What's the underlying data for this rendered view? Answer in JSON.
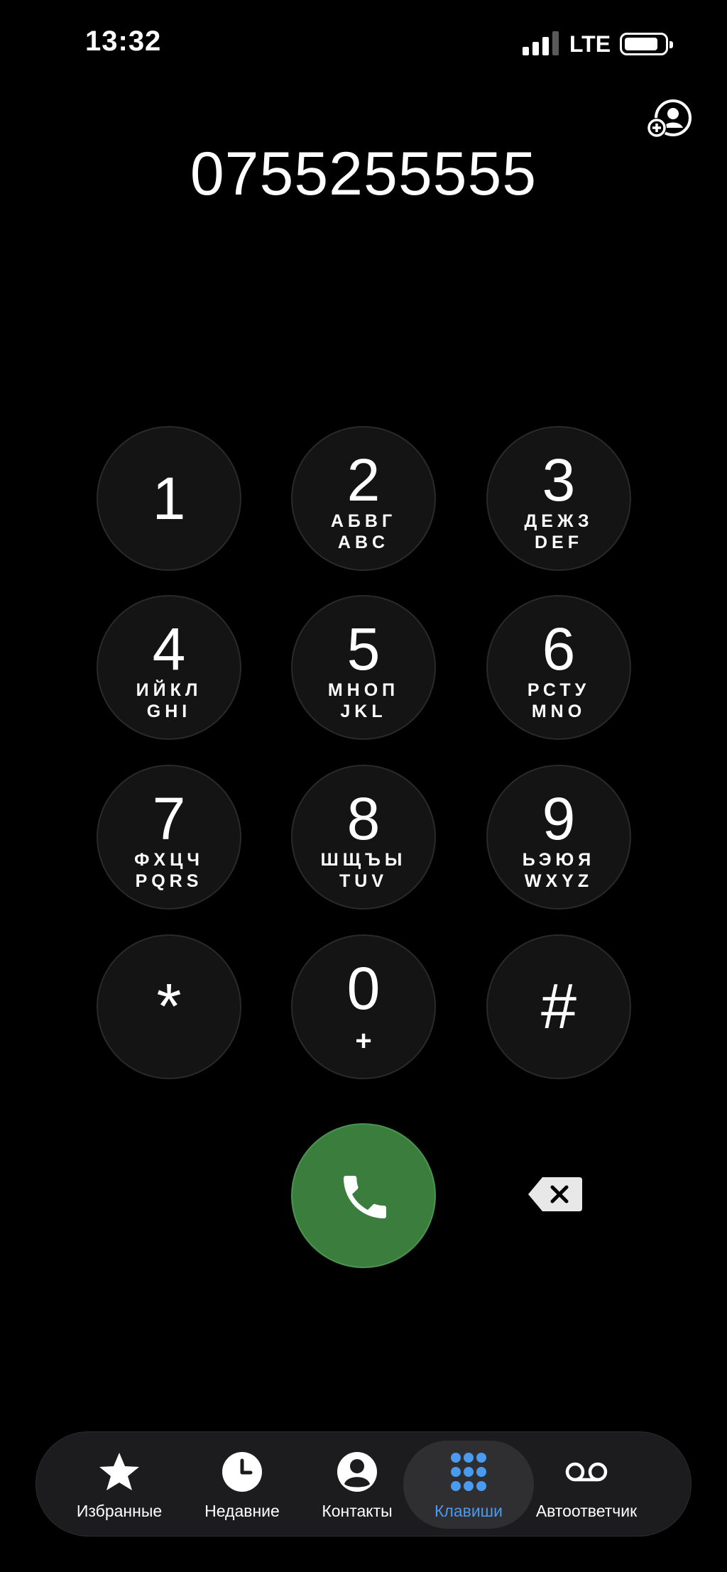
{
  "status_bar": {
    "time": "13:32",
    "network": "LTE",
    "signal_bars_active": 3,
    "signal_bars_total": 4,
    "battery_level": 0.85
  },
  "dialer": {
    "number": "0755255555",
    "keys": [
      {
        "digit": "1",
        "cyrillic": "",
        "latin": ""
      },
      {
        "digit": "2",
        "cyrillic": "АБВГ",
        "latin": "ABC"
      },
      {
        "digit": "3",
        "cyrillic": "ДЕЖЗ",
        "latin": "DEF"
      },
      {
        "digit": "4",
        "cyrillic": "ИЙКЛ",
        "latin": "GHI"
      },
      {
        "digit": "5",
        "cyrillic": "МНОП",
        "latin": "JKL"
      },
      {
        "digit": "6",
        "cyrillic": "РСТУ",
        "latin": "MNO"
      },
      {
        "digit": "7",
        "cyrillic": "ФХЦЧ",
        "latin": "PQRS"
      },
      {
        "digit": "8",
        "cyrillic": "ШЩЪЫ",
        "latin": "TUV"
      },
      {
        "digit": "9",
        "cyrillic": "ЬЭЮЯ",
        "latin": "WXYZ"
      },
      {
        "digit": "*",
        "cyrillic": "",
        "latin": ""
      },
      {
        "digit": "0",
        "cyrillic": "",
        "latin": "+"
      },
      {
        "digit": "#",
        "cyrillic": "",
        "latin": ""
      }
    ]
  },
  "tab_bar": {
    "active_index": 3,
    "items": [
      {
        "label": "Избранные",
        "icon": "star-icon"
      },
      {
        "label": "Недавние",
        "icon": "clock-icon"
      },
      {
        "label": "Контакты",
        "icon": "person-circle-icon"
      },
      {
        "label": "Клавиши",
        "icon": "keypad-icon"
      },
      {
        "label": "Автоответчик",
        "icon": "voicemail-icon"
      }
    ]
  },
  "colors": {
    "background": "#000000",
    "key_fill": "#141414",
    "call_green": "#3b7d3d",
    "active_tab": "#4a9bf0",
    "tab_bar": "#1c1c1e"
  }
}
